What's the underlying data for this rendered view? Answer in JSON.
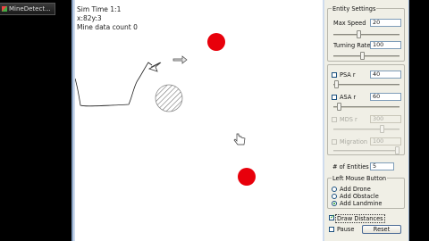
{
  "taskbar": {
    "item_label": "MineDetect..."
  },
  "simulation": {
    "sim_time": "Sim Time 1:1",
    "coords": "x:82y:3",
    "mine_data_count": "Mine data count 0"
  },
  "entity_settings": {
    "title": "Entity Settings",
    "max_speed": {
      "label": "Max Speed",
      "value": "20"
    },
    "turning_rate": {
      "label": "Turning Rate",
      "value": "100"
    },
    "psa": {
      "label": "PSA r",
      "value": "40",
      "checked": false,
      "enabled": true
    },
    "asa": {
      "label": "ASA r",
      "value": "60",
      "checked": false,
      "enabled": true
    },
    "mds": {
      "label": "MDS r",
      "value": "300",
      "checked": false,
      "enabled": false
    },
    "migration": {
      "label": "Migration",
      "value": "100",
      "checked": false,
      "enabled": false
    },
    "num_entities": {
      "label": "# of Entities",
      "value": "5"
    }
  },
  "left_mouse_button": {
    "title": "Left Mouse Button",
    "options": [
      {
        "label": "Add Drone",
        "selected": false
      },
      {
        "label": "Add Obstacle",
        "selected": false
      },
      {
        "label": "Add Landmine",
        "selected": true
      }
    ]
  },
  "controls": {
    "draw_distances": {
      "label": "Draw Distances",
      "checked": true
    },
    "pause": {
      "label": "Pause",
      "checked": false
    },
    "reset_label": "Reset"
  },
  "colors": {
    "landmine": "#e8000b",
    "obstacle_hatch": "#777777",
    "window_frame": "#cfdcee",
    "panel_bg": "#f0efe6"
  },
  "icons": [
    "drone-icon",
    "arrow-cursor-icon",
    "hand-cursor-icon",
    "checkbox-icon",
    "radio-icon"
  ]
}
